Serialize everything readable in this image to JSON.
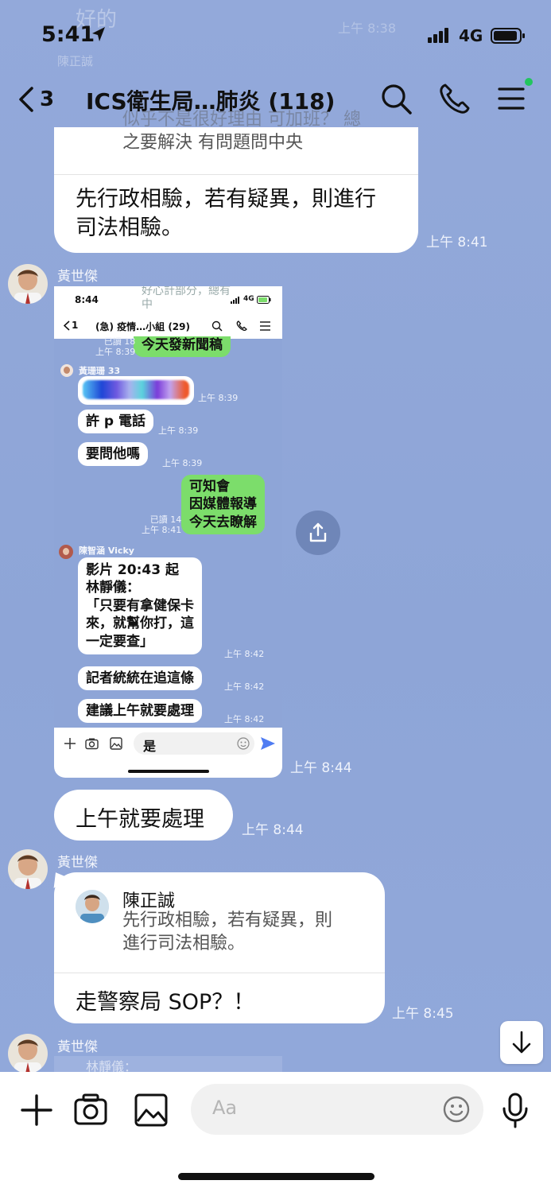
{
  "status": {
    "time": "5:41",
    "network": "4G"
  },
  "ghost": {
    "text": "好的",
    "time": "上午 8:38",
    "name": "陳正誠"
  },
  "header": {
    "back_count": "3",
    "title": "ICS衛生局…肺炎 (118)"
  },
  "messages": {
    "reply1": {
      "quoted_line1": "似乎不是很好理由 可加班？ 總",
      "quoted_line2": "之要解決 有問題問中央",
      "text_line1": "先行政相驗，若有疑異，則進行",
      "text_line2": "司法相驗。",
      "time": "上午 8:41"
    },
    "sender_huang": "黃世傑",
    "screenshot_time": "上午 8:44",
    "msg_am": {
      "text": "上午就要處理",
      "time": "上午 8:44"
    },
    "reply2": {
      "quoted_name": "陳正誠",
      "quoted_line1": "先行政相驗，若有疑異，則",
      "quoted_line2": "進行司法相驗。",
      "text": "走警察局 SOP？！",
      "time": "上午 8:45"
    },
    "next_sender": "黃世傑",
    "next_peek": "林靜儀："
  },
  "inner": {
    "status_time": "8:44",
    "network": "4G",
    "ghost_text": "好心計部分，總有",
    "ghost_text2": "中",
    "back_count": "1",
    "title": "(急) 疫情…小組 (29)",
    "read1": "已讀 18",
    "read1_time": "上午 8:39",
    "green1": "今天發新聞稿",
    "sender1": "黃珊珊 33",
    "t1": "上午 8:39",
    "bubble_call": "許 p 電話",
    "t2": "上午 8:39",
    "bubble_ask": "要問他嗎",
    "t3": "上午 8:39",
    "green2_l1": "可知會",
    "green2_l2": "因媒體報導",
    "green2_l3": "今天去瞭解",
    "read2": "已讀 14",
    "read2_time": "上午 8:41",
    "sender2": "陳智涵 Vicky",
    "video_l1": "影片 20:43 起",
    "video_l2": "林靜儀：",
    "video_l3": "「只要有拿健保卡",
    "video_l4": "來，就幫你打，這",
    "video_l5": "一定要查」",
    "t4": "上午 8:42",
    "bubble_reporters": "記者統統在追這條",
    "t5": "上午 8:42",
    "bubble_suggest": "建議上午就要處理",
    "t6": "上午 8:42",
    "input_text": "是"
  },
  "input": {
    "placeholder": "Aa"
  },
  "colors": {
    "chat_bg": "#8fa6d8",
    "green_bubble": "#7cdd6b",
    "online_dot": "#22c55e"
  }
}
